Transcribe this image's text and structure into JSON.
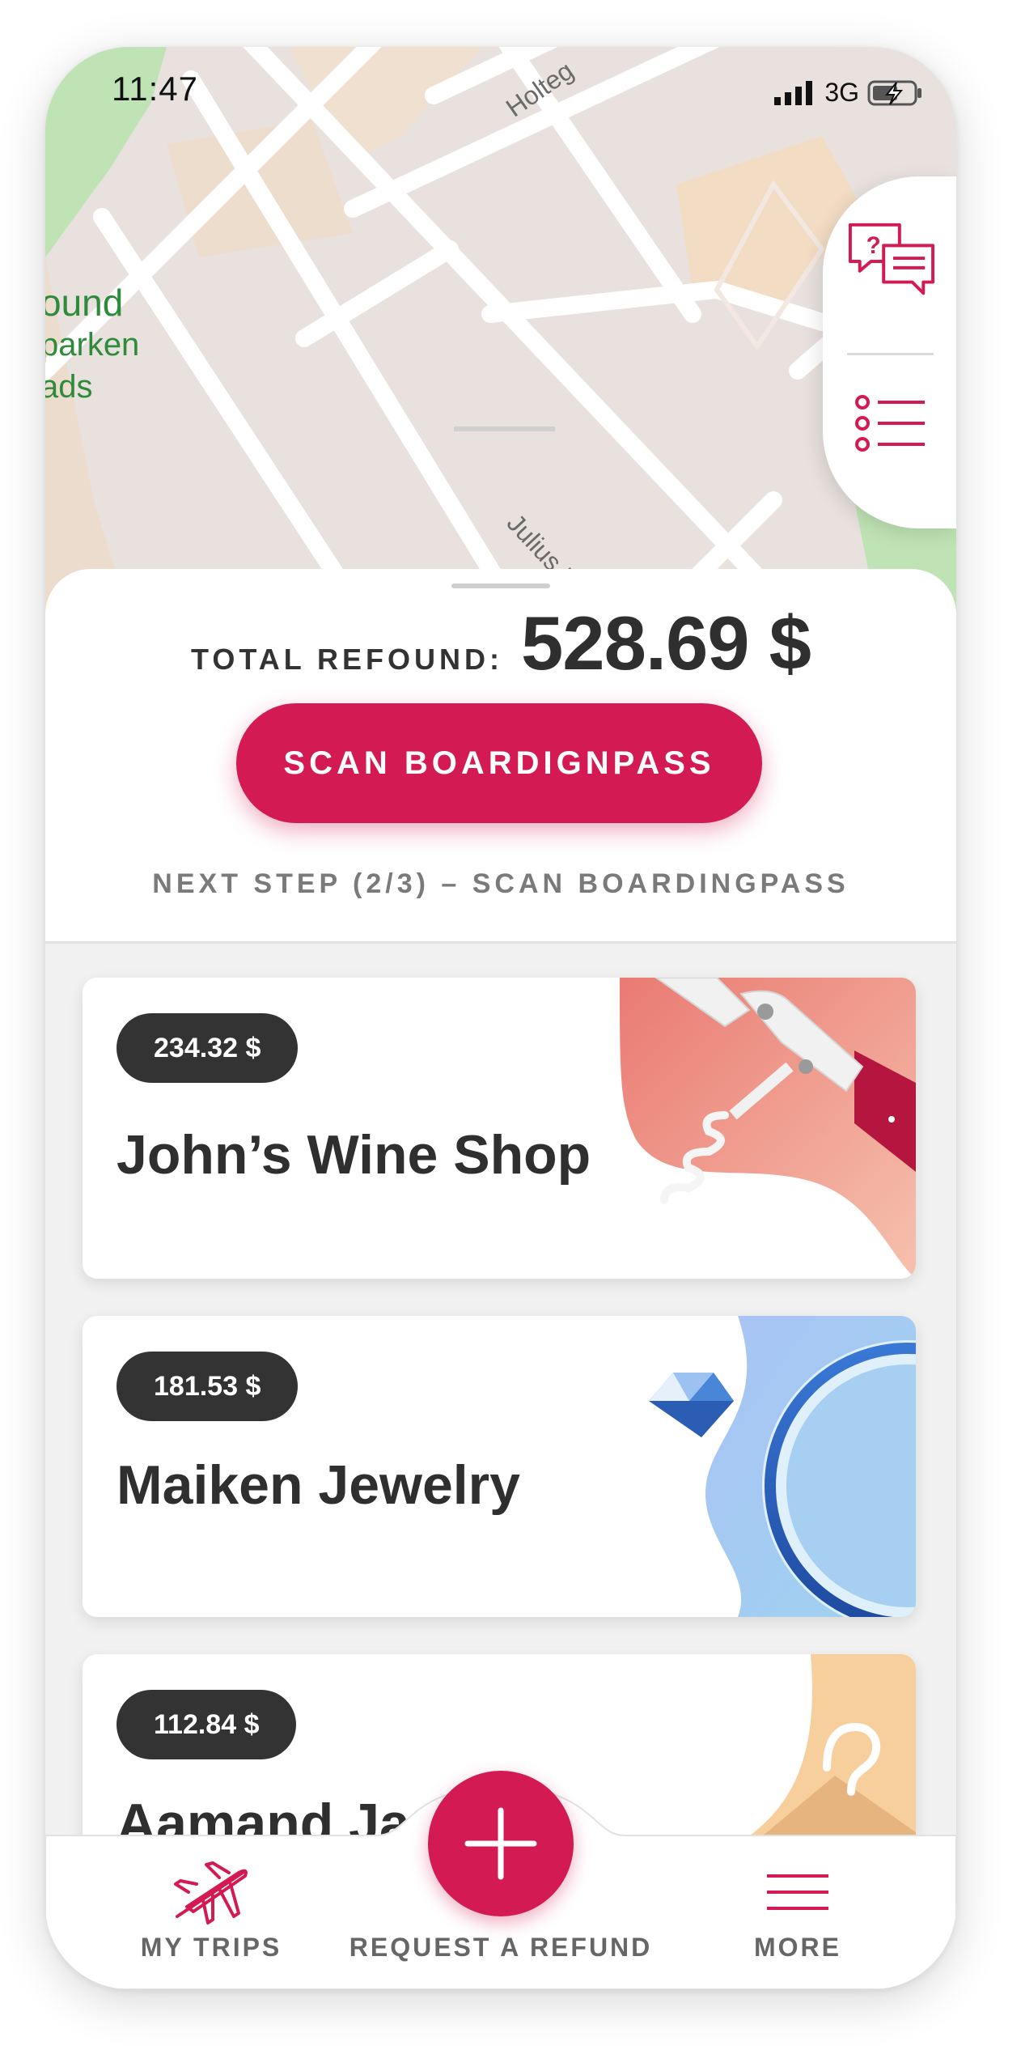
{
  "status": {
    "time": "11:47",
    "network": "3G"
  },
  "map": {
    "street_1": "Holteg",
    "street_2": "Julius Bloms G",
    "place_lines": [
      "ound",
      "parken",
      "ads"
    ]
  },
  "summary": {
    "total_label": "TOTAL REFOUND:",
    "total_value": "528.69 $",
    "scan_button": "SCAN BOARDIGNPASS",
    "next_step": "NEXT STEP (2/3) – SCAN BOARDINGPASS"
  },
  "receipts": [
    {
      "amount": "234.32 $",
      "shop": "John’s Wine Shop",
      "art": "corkscrew"
    },
    {
      "amount": "181.53 $",
      "shop": "Maiken Jewelry",
      "art": "diamond-ring"
    },
    {
      "amount": "112.84 $",
      "shop": "Aamand Ja",
      "art": "clothes-hanger"
    }
  ],
  "tabbar": {
    "my_trips": "MY TRIPS",
    "request_refund": "REQUEST A REFUND",
    "more": "MORE"
  },
  "colors": {
    "accent": "#d41a52",
    "badge": "#333333",
    "text_dark": "#2f2f2f"
  },
  "icons": [
    "help-chat-icon",
    "list-icon",
    "airplane-icon",
    "plus-icon",
    "hamburger-menu-icon"
  ]
}
